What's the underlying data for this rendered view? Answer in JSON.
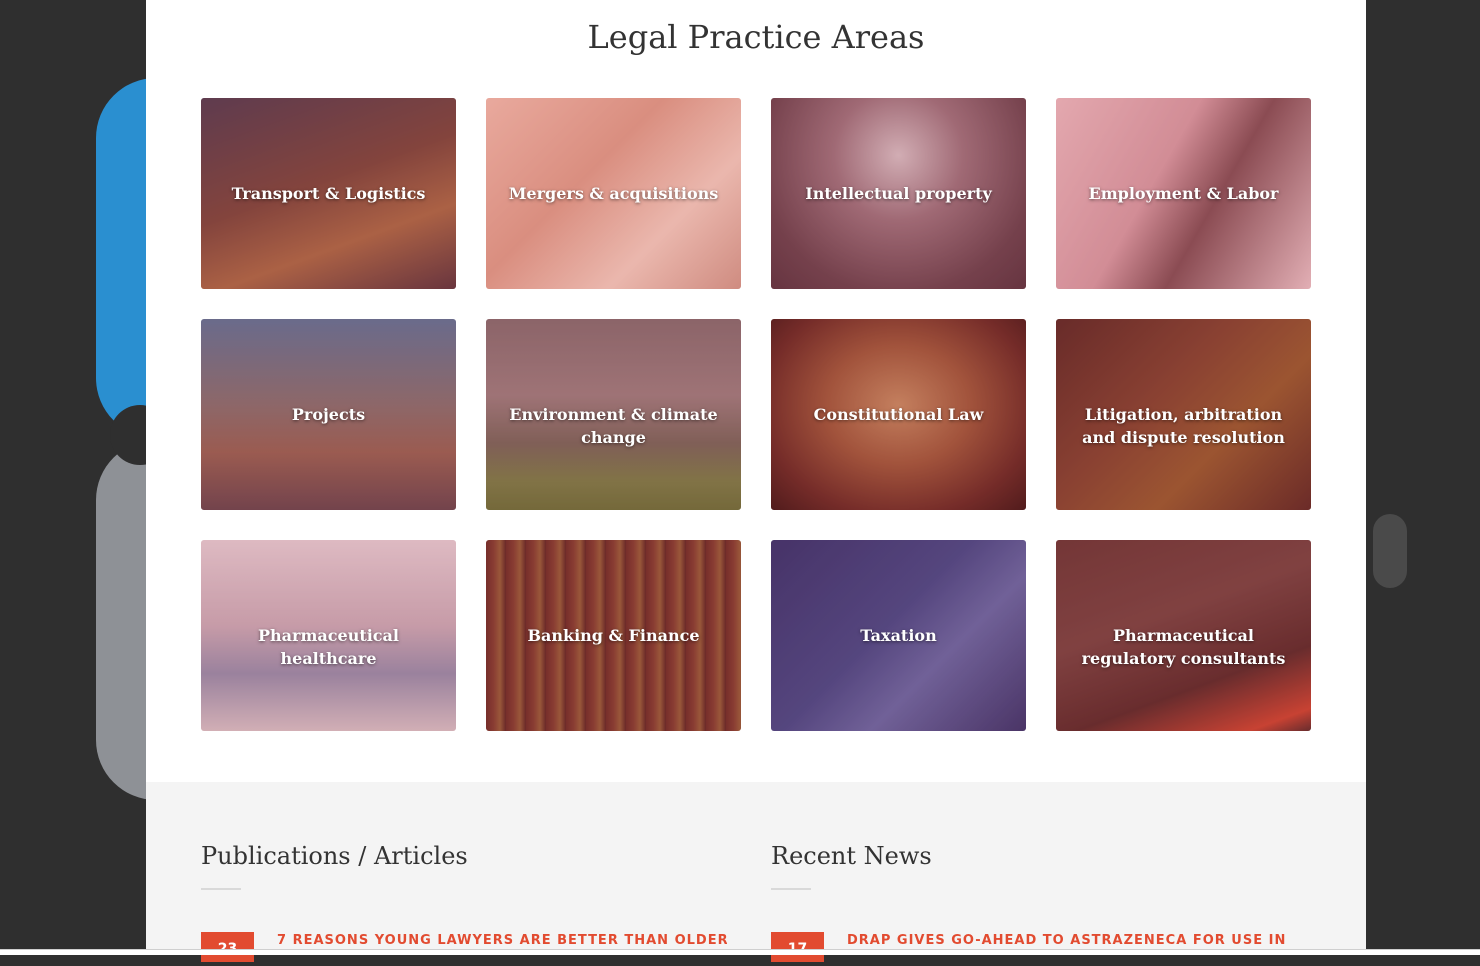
{
  "practice": {
    "title": "Legal Practice Areas",
    "tiles": [
      {
        "label": "Transport & Logistics"
      },
      {
        "label": "Mergers & acquisitions"
      },
      {
        "label": "Intellectual property"
      },
      {
        "label": "Employment & Labor"
      },
      {
        "label": "Projects"
      },
      {
        "label": "Environment & climate change"
      },
      {
        "label": "Constitutional Law"
      },
      {
        "label": "Litigation, arbitration and dispute resolution"
      },
      {
        "label": "Pharmaceutical healthcare"
      },
      {
        "label": "Banking & Finance"
      },
      {
        "label": "Taxation"
      },
      {
        "label": "Pharmaceutical regulatory consultants"
      }
    ]
  },
  "publications": {
    "title": "Publications / Articles",
    "item": {
      "date": "23",
      "title": "7 REASONS YOUNG LAWYERS ARE BETTER THAN OLDER"
    }
  },
  "news": {
    "title": "Recent News",
    "item": {
      "date": "17",
      "title": "DRAP GIVES GO-AHEAD TO ASTRAZENECA FOR USE IN"
    }
  },
  "colors": {
    "accent": "#e24b30",
    "tile_overlay": "#8b2f3a",
    "page_bg": "#2f2f2f",
    "deco_blue": "#2a8fd0",
    "deco_gray": "#8e9196"
  }
}
